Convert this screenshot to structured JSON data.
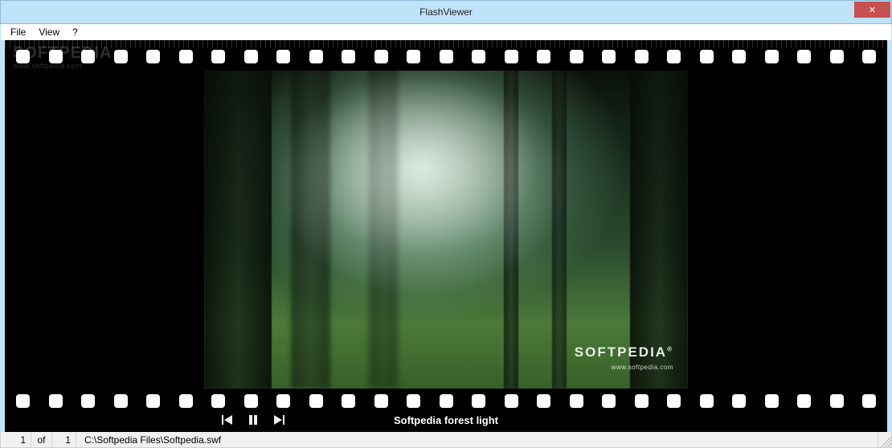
{
  "window": {
    "title": "FlashViewer"
  },
  "menubar": {
    "items": [
      "File",
      "View",
      "?"
    ]
  },
  "watermark": {
    "brand": "SOFTPEDIA",
    "url": "www.softpedia.com"
  },
  "content": {
    "caption": "Softpedia forest light",
    "overlay_brand": "SOFTPEDIA",
    "overlay_url": "www.softpedia.com"
  },
  "status": {
    "page_current": "1",
    "of_label": "of",
    "page_total": "1",
    "filepath": "C:\\Softpedia Files\\Softpedia.swf"
  },
  "colors": {
    "titlebar": "#bfe3f9",
    "close": "#c75050"
  }
}
